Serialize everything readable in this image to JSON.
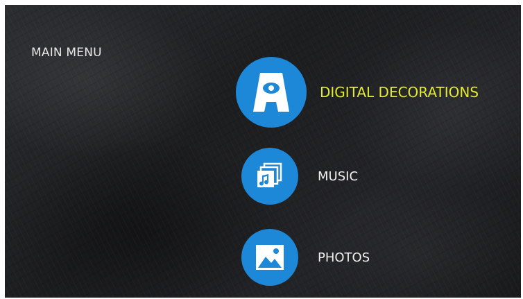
{
  "screen": {
    "title": "MAIN MENU"
  },
  "menu": {
    "items": [
      {
        "label": "DIGITAL DECORATIONS",
        "icon": "digital-decorations-icon",
        "selected": true
      },
      {
        "label": "MUSIC",
        "icon": "music-icon",
        "selected": false
      },
      {
        "label": "PHOTOS",
        "icon": "photos-icon",
        "selected": false
      }
    ]
  },
  "colors": {
    "accent": "#1e88d8",
    "selected_text": "#e2ea32",
    "text": "#f0f0f0",
    "background": "#1f2022"
  }
}
